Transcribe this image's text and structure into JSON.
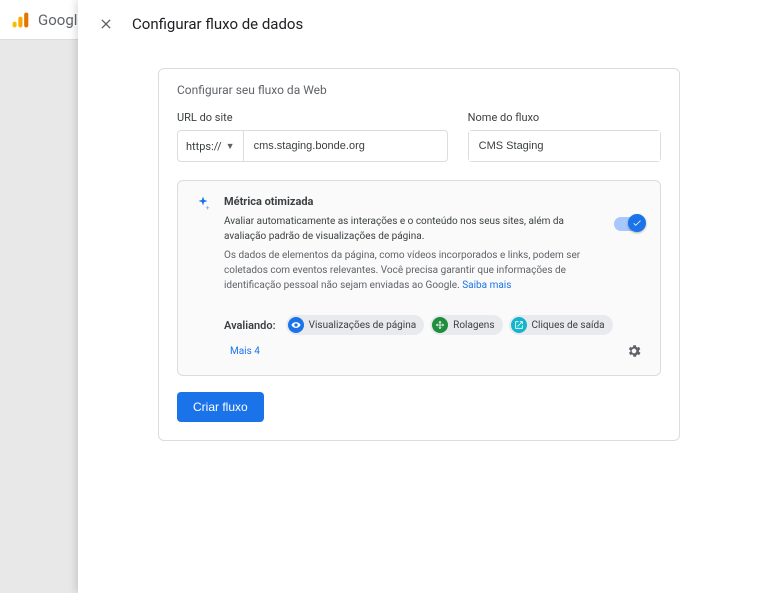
{
  "background": {
    "brand": "Googl"
  },
  "panel": {
    "title": "Configurar fluxo de dados"
  },
  "card": {
    "section_title": "Configurar seu fluxo da Web",
    "url_label": "URL do site",
    "protocol": "https://",
    "url_value": "cms.staging.bonde.org",
    "name_label": "Nome do fluxo",
    "name_value": "CMS Staging"
  },
  "metric": {
    "heading": "Métrica otimizada",
    "desc": "Avaliar automaticamente as interações e o conteúdo nos seus sites, além da avaliação padrão de visualizações de página.",
    "note_prefix": "Os dados de elementos da página, como vídeos incorporados e links, podem ser coletados com eventos relevantes. Você precisa garantir que informações de identificação pessoal não sejam enviadas ao Google. ",
    "learn_more": "Saiba mais"
  },
  "eval": {
    "label": "Avaliando:",
    "chips": [
      {
        "icon": "eye",
        "label": "Visualizações de página"
      },
      {
        "icon": "scroll",
        "label": "Rolagens"
      },
      {
        "icon": "out",
        "label": "Cliques de saída"
      }
    ],
    "more": "Mais 4"
  },
  "actions": {
    "create": "Criar fluxo"
  }
}
